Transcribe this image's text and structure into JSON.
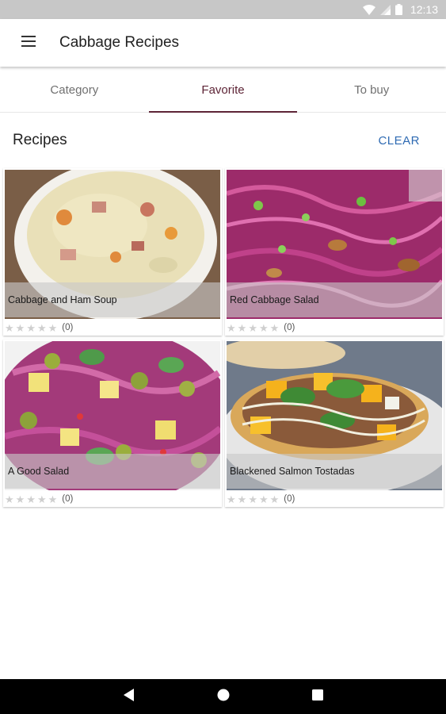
{
  "status_bar": {
    "time": "12:13"
  },
  "app_bar": {
    "title": "Cabbage Recipes",
    "menu_icon": "hamburger-menu-icon"
  },
  "tabs": [
    {
      "label": "Category",
      "active": false
    },
    {
      "label": "Favorite",
      "active": true
    },
    {
      "label": "To buy",
      "active": false
    }
  ],
  "section": {
    "title": "Recipes",
    "clear_label": "CLEAR"
  },
  "recipes": [
    {
      "name": "Cabbage and Ham Soup",
      "rating_count": "(0)",
      "stars": 0
    },
    {
      "name": "Red Cabbage Salad",
      "rating_count": "(0)",
      "stars": 0
    },
    {
      "name": "A Good Salad",
      "rating_count": "(0)",
      "stars": 0
    },
    {
      "name": "Blackened Salmon Tostadas",
      "rating_count": "(0)",
      "stars": 0
    }
  ],
  "colors": {
    "accent": "#5d2436",
    "clear": "#2f6bb3",
    "status_bar": "#c7c7c7"
  }
}
